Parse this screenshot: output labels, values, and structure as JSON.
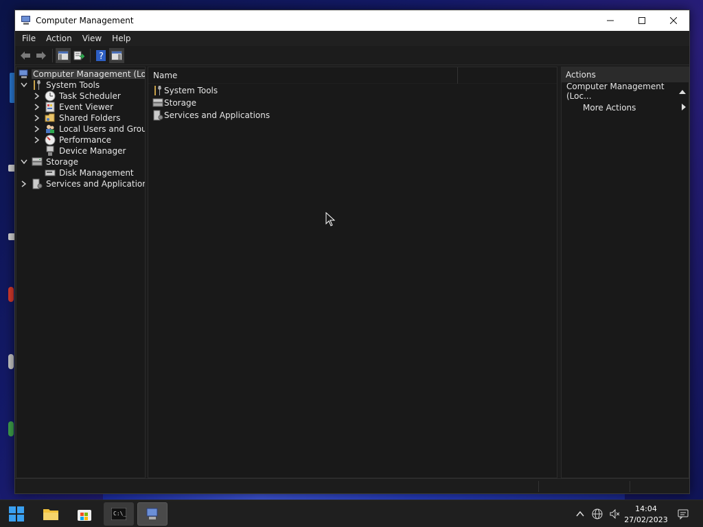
{
  "window": {
    "title": "Computer Management",
    "minimize_glyph": "—",
    "maximize_glyph": "☐",
    "close_glyph": "✕"
  },
  "menu": [
    "File",
    "Action",
    "View",
    "Help"
  ],
  "toolbar": {
    "buttons": [
      "back-arrow-icon",
      "forward-arrow-icon",
      "show-hide-console-tree-icon",
      "export-list-icon",
      "help-icon",
      "show-hide-action-pane-icon"
    ]
  },
  "tree": {
    "root": "Computer Management (Local)",
    "system_tools": "System Tools",
    "task_scheduler": "Task Scheduler",
    "event_viewer": "Event Viewer",
    "shared_folders": "Shared Folders",
    "local_users": "Local Users and Groups",
    "performance": "Performance",
    "device_manager": "Device Manager",
    "storage": "Storage",
    "disk_management": "Disk Management",
    "services": "Services and Applications"
  },
  "list": {
    "column_name": "Name",
    "items": [
      "System Tools",
      "Storage",
      "Services and Applications"
    ]
  },
  "actions": {
    "header": "Actions",
    "section": "Computer Management (Loc...",
    "more": "More Actions"
  },
  "taskbar": {
    "time": "14:04",
    "date": "27/02/2023"
  },
  "colors": {
    "window_bg": "#1c1c1c",
    "titlebar_bg": "#ffffff",
    "accent_blue": "#0078d4"
  }
}
